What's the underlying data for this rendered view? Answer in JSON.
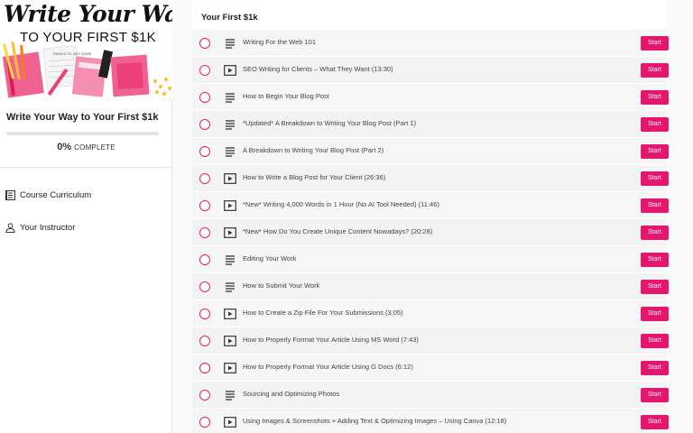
{
  "cover": {
    "title": "Write Your Way",
    "subtitle": "TO YOUR FIRST $1K",
    "note_text": "THINGS TO GET DONE"
  },
  "sidebar": {
    "course_title": "Write Your Way to Your First $1k",
    "progress": {
      "percent_text": "0%",
      "label": "COMPLETE",
      "fraction": 0
    },
    "nav": [
      {
        "label": "Course Curriculum",
        "icon": "curriculum-icon"
      },
      {
        "label": "Your Instructor",
        "icon": "person-icon"
      }
    ]
  },
  "main": {
    "section_title": "Your First $1k",
    "start_label": "Start",
    "lessons": [
      {
        "title": "Writing For the Web 101",
        "type": "text"
      },
      {
        "title": "SEO Writing for Clients – What They Want (13:30)",
        "type": "video"
      },
      {
        "title": "How to Begin Your Blog Post",
        "type": "text"
      },
      {
        "title": "*Updated* A Breakdown to Writing Your Blog Post (Part 1)",
        "type": "text"
      },
      {
        "title": "A Breakdown to Writing Your Blog Post (Part 2)",
        "type": "text"
      },
      {
        "title": "How to Write a Blog Post for Your Client (26:36)",
        "type": "video"
      },
      {
        "title": "*New* Writing 4,000 Words in 1 Hour (No AI Tool Needed) (11:46)",
        "type": "video"
      },
      {
        "title": "*New* How Do You Create Unique Content Nowadays? (20:28)",
        "type": "video"
      },
      {
        "title": "Editing Your Work",
        "type": "text"
      },
      {
        "title": "How to Submit Your Work",
        "type": "text"
      },
      {
        "title": "How to Create a Zip File For Your Submissions (3:05)",
        "type": "video"
      },
      {
        "title": "How to Properly Format Your Article Using MS Word (7:43)",
        "type": "video"
      },
      {
        "title": "How to Properly Format Your Article Using G Docs (6:12)",
        "type": "video"
      },
      {
        "title": "Sourcing and Optimizing Photos",
        "type": "text"
      },
      {
        "title": "Using Images & Screenshots + Adding Text & Optimizing Images – Using Canva (12:18)",
        "type": "video"
      }
    ]
  },
  "colors": {
    "accent": "#e4176f",
    "circle": "#e91e63"
  }
}
